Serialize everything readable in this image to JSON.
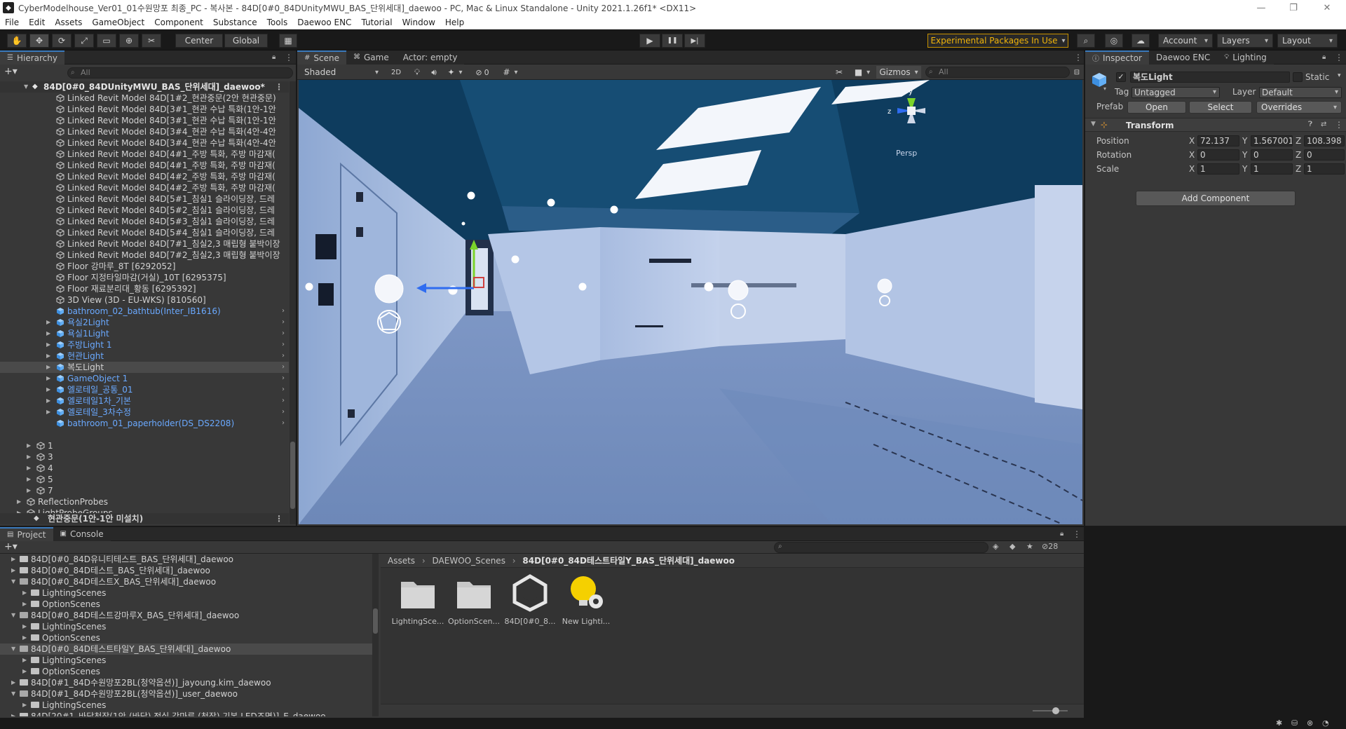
{
  "window": {
    "title": "CyberModelhouse_Ver01_01수원망포 최종_PC - 복사본 - 84D[0#0_84DUnityMWU_BAS_단위세대]_daewoo - PC, Mac & Linux Standalone - Unity 2021.1.26f1* <DX11>",
    "logo_glyph": "◆",
    "minimize_glyph": "—",
    "maximize_glyph": "❐",
    "close_glyph": "✕"
  },
  "menu": [
    "File",
    "Edit",
    "Assets",
    "GameObject",
    "Component",
    "Substance",
    "Tools",
    "Daewoo ENC",
    "Tutorial",
    "Window",
    "Help"
  ],
  "toolbar": {
    "center": "Center",
    "global": "Global",
    "experimental": "Experimental Packages In Use",
    "account": "Account",
    "layers": "Layers",
    "layout": "Layout",
    "play_glyph": "▶",
    "pause_glyph": "❚❚",
    "step_glyph": "▶|",
    "tool_glyphs": [
      "✋",
      "✥",
      "⟳",
      "⤢",
      "▭",
      "⊕",
      "✂"
    ],
    "extra_glyph": "▦",
    "search_glyph": "⌕",
    "collab_glyph": "◎",
    "cloud_glyph": "☁"
  },
  "hierarchy": {
    "tab": "Hierarchy",
    "search_placeholder": "All",
    "scene_name": "84D[0#0_84DUnityMWU_BAS_단위세대]_daewoo*",
    "bottom_scene": "현관중문(1안-1안 미설치)",
    "items": [
      {
        "label": "Linked Revit Model 84D[1#2_현관중문(2안 현관중문)",
        "depth": 6,
        "blue": false,
        "arrow": false,
        "more": false
      },
      {
        "label": "Linked Revit Model 84D[3#1_현관 수납 특화(1안-1안",
        "depth": 6,
        "blue": false,
        "arrow": false,
        "more": false
      },
      {
        "label": "Linked Revit Model 84D[3#1_현관 수납 특화(1안-1안",
        "depth": 6,
        "blue": false,
        "arrow": false,
        "more": false
      },
      {
        "label": "Linked Revit Model 84D[3#4_현관 수납 특화(4안-4안",
        "depth": 6,
        "blue": false,
        "arrow": false,
        "more": false
      },
      {
        "label": "Linked Revit Model 84D[3#4_현관 수납 특화(4안-4안",
        "depth": 6,
        "blue": false,
        "arrow": false,
        "more": false
      },
      {
        "label": "Linked Revit Model 84D[4#1_주방 특화, 주방 마감재(",
        "depth": 6,
        "blue": false,
        "arrow": false,
        "more": false
      },
      {
        "label": "Linked Revit Model 84D[4#1_주방 특화, 주방 마감재(",
        "depth": 6,
        "blue": false,
        "arrow": false,
        "more": false
      },
      {
        "label": "Linked Revit Model 84D[4#2_주방 특화, 주방 마감재(",
        "depth": 6,
        "blue": false,
        "arrow": false,
        "more": false
      },
      {
        "label": "Linked Revit Model 84D[4#2_주방 특화, 주방 마감재(",
        "depth": 6,
        "blue": false,
        "arrow": false,
        "more": false
      },
      {
        "label": "Linked Revit Model 84D[5#1_침실1 슬라이딩장, 드레",
        "depth": 6,
        "blue": false,
        "arrow": false,
        "more": false
      },
      {
        "label": "Linked Revit Model 84D[5#2_침실1 슬라이딩장, 드레",
        "depth": 6,
        "blue": false,
        "arrow": false,
        "more": false
      },
      {
        "label": "Linked Revit Model 84D[5#3_침실1 슬라이딩장, 드레",
        "depth": 6,
        "blue": false,
        "arrow": false,
        "more": false
      },
      {
        "label": "Linked Revit Model 84D[5#4_침실1 슬라이딩장, 드레",
        "depth": 6,
        "blue": false,
        "arrow": false,
        "more": false
      },
      {
        "label": "Linked Revit Model 84D[7#1_침실2,3 매립형 붙박이장",
        "depth": 6,
        "blue": false,
        "arrow": false,
        "more": false
      },
      {
        "label": "Linked Revit Model 84D[7#2_침실2,3 매립형 붙박이장",
        "depth": 6,
        "blue": false,
        "arrow": false,
        "more": false
      },
      {
        "label": "Floor 강마루_8T [6292052]",
        "depth": 6,
        "blue": false,
        "arrow": false,
        "more": false
      },
      {
        "label": "Floor 지정타일마감(거실)_10T [6295375]",
        "depth": 6,
        "blue": false,
        "arrow": false,
        "more": false
      },
      {
        "label": "Floor 재료분리대_황동 [6295392]",
        "depth": 6,
        "blue": false,
        "arrow": false,
        "more": false
      },
      {
        "label": "3D View (3D - EU-WKS) [810560]",
        "depth": 6,
        "blue": false,
        "arrow": false,
        "more": false
      },
      {
        "label": "bathroom_02_bathtub(Inter_IB1616)",
        "depth": 6,
        "blue": true,
        "arrow": false,
        "more": true
      },
      {
        "label": "욕실2Light",
        "depth": 6,
        "blue": true,
        "arrow": true,
        "more": true
      },
      {
        "label": "욕실1Light",
        "depth": 6,
        "blue": true,
        "arrow": true,
        "more": true
      },
      {
        "label": "주방Light 1",
        "depth": 6,
        "blue": true,
        "arrow": true,
        "more": true
      },
      {
        "label": "현관Light",
        "depth": 6,
        "blue": true,
        "arrow": true,
        "more": true
      },
      {
        "label": "복도Light",
        "depth": 6,
        "blue": false,
        "arrow": true,
        "more": true,
        "sel": true
      },
      {
        "label": "GameObject 1",
        "depth": 6,
        "blue": true,
        "arrow": true,
        "more": true
      },
      {
        "label": "엘로테일_공통_01",
        "depth": 6,
        "blue": true,
        "arrow": true,
        "more": true
      },
      {
        "label": "엘로테일1차_기본",
        "depth": 6,
        "blue": true,
        "arrow": true,
        "more": true
      },
      {
        "label": "엘로테일_3차수정",
        "depth": 6,
        "blue": true,
        "arrow": true,
        "more": true
      },
      {
        "label": "bathroom_01_paperholder(DS_DS2208)",
        "depth": 6,
        "blue": true,
        "arrow": false,
        "more": true
      },
      {
        "label": "",
        "depth": 0,
        "blue": false,
        "arrow": false,
        "more": false
      },
      {
        "label": "1",
        "depth": 4,
        "blue": false,
        "arrow": true,
        "more": false
      },
      {
        "label": "3",
        "depth": 4,
        "blue": false,
        "arrow": true,
        "more": false
      },
      {
        "label": "4",
        "depth": 4,
        "blue": false,
        "arrow": true,
        "more": false
      },
      {
        "label": "5",
        "depth": 4,
        "blue": false,
        "arrow": true,
        "more": false
      },
      {
        "label": "7",
        "depth": 4,
        "blue": false,
        "arrow": true,
        "more": false
      },
      {
        "label": "ReflectionProbes",
        "depth": 3,
        "blue": false,
        "arrow": true,
        "more": false
      },
      {
        "label": "LightProbeGroups",
        "depth": 3,
        "blue": false,
        "arrow": true,
        "more": false
      },
      {
        "label": "LightProbeProxyVolumes",
        "depth": 3,
        "blue": false,
        "arrow": true,
        "more": false
      }
    ]
  },
  "scene": {
    "tabs": [
      "Scene",
      "Game"
    ],
    "actor": "Actor: empty",
    "shading": "Shaded",
    "mode2d": "2D",
    "hidden_count": "0",
    "gizmos": "Gizmos",
    "search_placeholder": "All",
    "persp": "Persp",
    "axis_x": "x",
    "axis_y": "y",
    "axis_z": "z"
  },
  "inspector": {
    "tabs": [
      "Inspector",
      "Daewoo ENC",
      "Lighting"
    ],
    "object_name": "복도Light",
    "static_label": "Static",
    "tag_label": "Tag",
    "tag_value": "Untagged",
    "layer_label": "Layer",
    "layer_value": "Default",
    "prefab_label": "Prefab",
    "open": "Open",
    "select": "Select",
    "overrides": "Overrides",
    "transform_title": "Transform",
    "position_label": "Position",
    "rotation_label": "Rotation",
    "scale_label": "Scale",
    "axis_x": "X",
    "axis_y": "Y",
    "axis_z": "Z",
    "position": [
      "72.137",
      "1.567001",
      "108.398"
    ],
    "rotation": [
      "0",
      "0",
      "0"
    ],
    "scale": [
      "1",
      "1",
      "1"
    ],
    "add_component": "Add Component"
  },
  "project": {
    "tabs": [
      "Project",
      "Console"
    ],
    "hidden_count": "28",
    "breadcrumb": [
      "Assets",
      "DAEWOO_Scenes",
      "84D[0#0_84D테스트타일Y_BAS_단위세대]_daewoo"
    ],
    "tree": [
      {
        "label": "84D[0#0_84D유니티테스트_BAS_단위세대]_daewoo",
        "depth": 2,
        "open": false
      },
      {
        "label": "84D[0#0_84D테스트_BAS_단위세대]_daewoo",
        "depth": 2,
        "open": false
      },
      {
        "label": "84D[0#0_84D테스트X_BAS_단위세대]_daewoo",
        "depth": 2,
        "open": true
      },
      {
        "label": "LightingScenes",
        "depth": 3,
        "open": false
      },
      {
        "label": "OptionScenes",
        "depth": 3,
        "open": false
      },
      {
        "label": "84D[0#0_84D테스트강마루X_BAS_단위세대]_daewoo",
        "depth": 2,
        "open": true
      },
      {
        "label": "LightingScenes",
        "depth": 3,
        "open": false
      },
      {
        "label": "OptionScenes",
        "depth": 3,
        "open": false
      },
      {
        "label": "84D[0#0_84D테스트타일Y_BAS_단위세대]_daewoo",
        "depth": 2,
        "open": true,
        "sel": true
      },
      {
        "label": "LightingScenes",
        "depth": 3,
        "open": false
      },
      {
        "label": "OptionScenes",
        "depth": 3,
        "open": false
      },
      {
        "label": "84D[0#1_84D수원망포2BL(청약옵션)]_jayoung.kim_daewoo",
        "depth": 2,
        "open": false
      },
      {
        "label": "84D[0#1_84D수원망포2BL(청약옵션)]_user_daewoo",
        "depth": 2,
        "open": true
      },
      {
        "label": "LightingScenes",
        "depth": 3,
        "open": false
      },
      {
        "label": "84D[20#1_바닥천장(1안-(바닥) 전실 강마루 (천장) 기본 LED조명)]_E_daewoo",
        "depth": 2,
        "open": false
      }
    ],
    "assets": [
      {
        "label": "LightingSce...",
        "kind": "folder"
      },
      {
        "label": "OptionScen...",
        "kind": "folder"
      },
      {
        "label": "84D[0#0_8...",
        "kind": "unity"
      },
      {
        "label": "New Lighti...",
        "kind": "lighting"
      }
    ]
  },
  "colors": {
    "accent": "#3a79bb",
    "warning": "#f0b40a",
    "prefab_blue": "#6aa9ff",
    "bg_panel": "#383838"
  }
}
